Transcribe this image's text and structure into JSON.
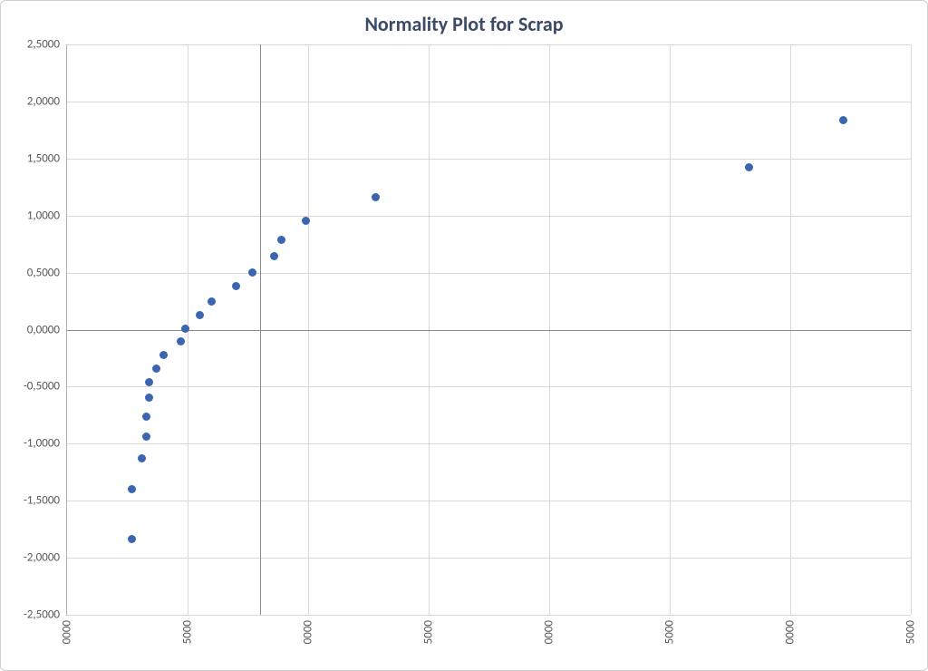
{
  "chart_data": {
    "type": "scatter",
    "title": "Normality Plot for Scrap",
    "xlabel": "",
    "ylabel": "",
    "xlim": [
      10000,
      45000
    ],
    "ylim": [
      -2.5,
      2.5
    ],
    "x_ticks": [
      10000,
      15000,
      20000,
      25000,
      30000,
      35000,
      40000,
      45000
    ],
    "x_tick_format": "suffix-0000-drop-leading",
    "y_ticks": [
      -2.5,
      -2.0,
      -1.5,
      -1.0,
      -0.5,
      0.0,
      0.5,
      1.0,
      1.5,
      2.0,
      2.5
    ],
    "y_tick_format": "comma-4dp",
    "series": [
      {
        "name": "Scrap",
        "color": "#3a66b0",
        "points": [
          {
            "x": 12700,
            "y": -1.84
          },
          {
            "x": 12700,
            "y": -1.4
          },
          {
            "x": 13100,
            "y": -1.13
          },
          {
            "x": 13300,
            "y": -0.94
          },
          {
            "x": 13300,
            "y": -0.76
          },
          {
            "x": 13400,
            "y": -0.6
          },
          {
            "x": 13400,
            "y": -0.46
          },
          {
            "x": 13700,
            "y": -0.34
          },
          {
            "x": 14000,
            "y": -0.22
          },
          {
            "x": 14700,
            "y": -0.1
          },
          {
            "x": 14900,
            "y": 0.01
          },
          {
            "x": 15500,
            "y": 0.13
          },
          {
            "x": 16000,
            "y": 0.25
          },
          {
            "x": 17000,
            "y": 0.38
          },
          {
            "x": 17700,
            "y": 0.5
          },
          {
            "x": 18600,
            "y": 0.64
          },
          {
            "x": 18900,
            "y": 0.79
          },
          {
            "x": 19900,
            "y": 0.95
          },
          {
            "x": 22800,
            "y": 1.16
          },
          {
            "x": 38300,
            "y": 1.42
          },
          {
            "x": 42200,
            "y": 1.84
          }
        ]
      }
    ]
  },
  "colors": {
    "point": "#3a66b0",
    "grid": "#d9d9d9",
    "axis": "#8a8a8a",
    "title": "#3b4a66"
  }
}
